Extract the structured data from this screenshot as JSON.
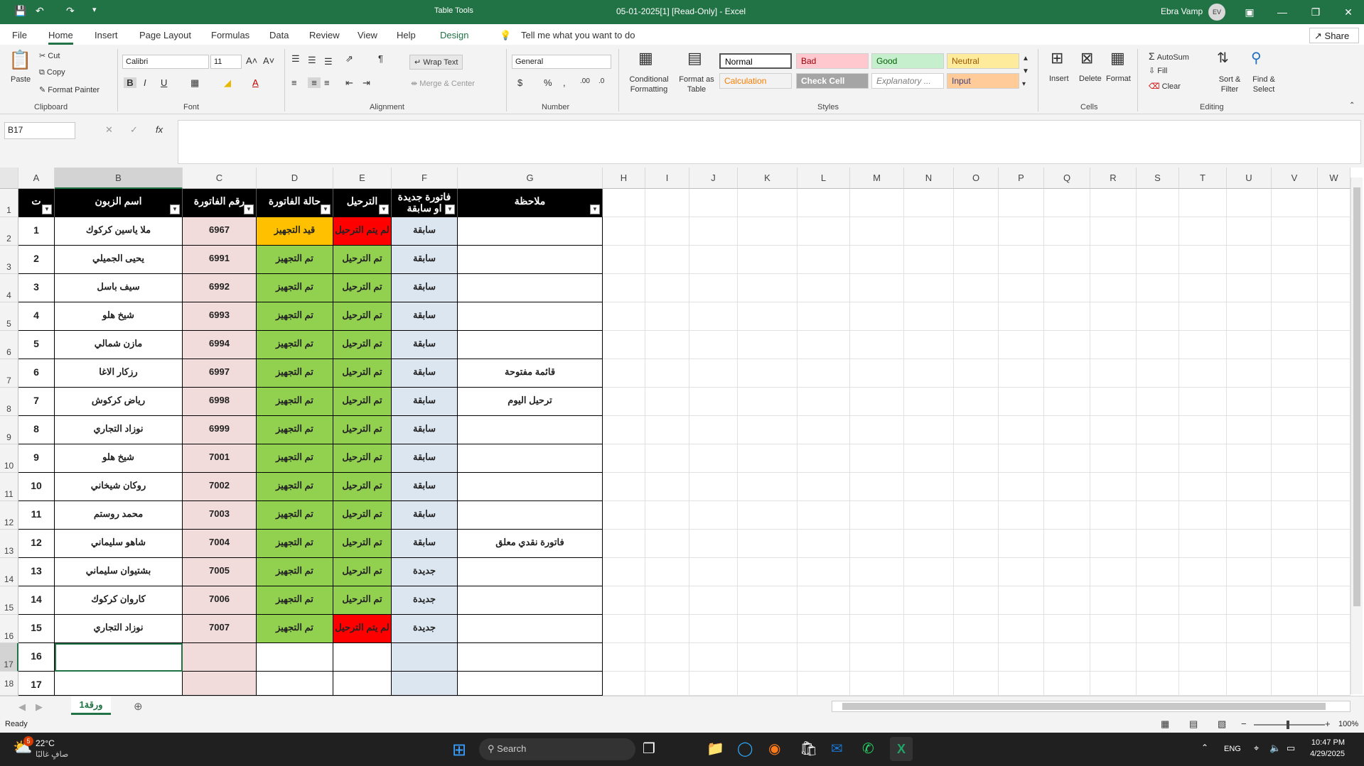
{
  "titlebar": {
    "context_tab": "Table Tools",
    "doc_title": "05-01-2025[1]  [Read-Only]  -  Excel",
    "user": "Ebra Vamp",
    "avatar": "EV"
  },
  "menu": [
    "File",
    "Home",
    "Insert",
    "Page Layout",
    "Formulas",
    "Data",
    "Review",
    "View",
    "Help",
    "Design"
  ],
  "tell_me": "Tell me what you want to do",
  "share": "Share",
  "ribbon": {
    "clipboard": {
      "paste": "Paste",
      "cut": "Cut",
      "copy": "Copy",
      "format_painter": "Format Painter",
      "group": "Clipboard"
    },
    "font": {
      "name": "Calibri",
      "size": "11",
      "group": "Font"
    },
    "alignment": {
      "wrap": "Wrap Text",
      "merge": "Merge & Center",
      "group": "Alignment"
    },
    "number": {
      "format": "General",
      "group": "Number"
    },
    "styles": {
      "cond": "Conditional Formatting",
      "format_table": "Format as Table",
      "group": "Styles",
      "cells": [
        {
          "label": "Normal",
          "bg": "#ffffff",
          "fg": "#000000"
        },
        {
          "label": "Bad",
          "bg": "#ffc7ce",
          "fg": "#9c0006"
        },
        {
          "label": "Good",
          "bg": "#c6efce",
          "fg": "#006100"
        },
        {
          "label": "Neutral",
          "bg": "#ffeb9c",
          "fg": "#9c5700"
        },
        {
          "label": "Calculation",
          "bg": "#f2f2f2",
          "fg": "#fa7d00"
        },
        {
          "label": "Check Cell",
          "bg": "#a5a5a5",
          "fg": "#ffffff"
        },
        {
          "label": "Explanatory ...",
          "bg": "#ffffff",
          "fg": "#7f7f7f"
        },
        {
          "label": "Input",
          "bg": "#ffcc99",
          "fg": "#3f3f76"
        }
      ]
    },
    "cells": {
      "insert": "Insert",
      "delete": "Delete",
      "format": "Format",
      "group": "Cells"
    },
    "editing": {
      "autosum": "AutoSum",
      "fill": "Fill",
      "clear": "Clear",
      "sort": "Sort & Filter",
      "find": "Find & Select",
      "group": "Editing"
    }
  },
  "formula": {
    "namebox": "B17",
    "fx": "fx",
    "value": ""
  },
  "columns": [
    "A",
    "B",
    "C",
    "D",
    "E",
    "F",
    "G",
    "H",
    "I",
    "J",
    "K",
    "L",
    "M",
    "N",
    "O",
    "P",
    "Q",
    "R",
    "S",
    "T",
    "U",
    "V",
    "W"
  ],
  "headers": {
    "a": "ت",
    "b": "اسم الزبون",
    "c": "رقم الفاتورة",
    "d": "حالة الفاتورة",
    "e": "الترحيل",
    "f1": "فاتورة جديدة",
    "f2": "او سابقة",
    "g": "ملاحظة"
  },
  "rows": [
    {
      "n": "1",
      "name": "ملا ياسين كركوك",
      "inv": "6967",
      "status": "قيد التجهيز",
      "ship": "لم يتم الترحيل",
      "type": "سابقة",
      "note": ""
    },
    {
      "n": "2",
      "name": "يحيى الجميلي",
      "inv": "6991",
      "status": "تم التجهيز",
      "ship": "تم الترحيل",
      "type": "سابقة",
      "note": ""
    },
    {
      "n": "3",
      "name": "سيف باسل",
      "inv": "6992",
      "status": "تم التجهيز",
      "ship": "تم الترحيل",
      "type": "سابقة",
      "note": ""
    },
    {
      "n": "4",
      "name": "شيخ هلو",
      "inv": "6993",
      "status": "تم التجهيز",
      "ship": "تم الترحيل",
      "type": "سابقة",
      "note": ""
    },
    {
      "n": "5",
      "name": "مازن شمالي",
      "inv": "6994",
      "status": "تم التجهيز",
      "ship": "تم الترحيل",
      "type": "سابقة",
      "note": ""
    },
    {
      "n": "6",
      "name": "رزكار الاغا",
      "inv": "6997",
      "status": "تم التجهيز",
      "ship": "تم الترحيل",
      "type": "سابقة",
      "note": "قائمة مفتوحة"
    },
    {
      "n": "7",
      "name": "رياض كركوش",
      "inv": "6998",
      "status": "تم التجهيز",
      "ship": "تم الترحيل",
      "type": "سابقة",
      "note": "ترحيل اليوم"
    },
    {
      "n": "8",
      "name": "نوزاد التجاري",
      "inv": "6999",
      "status": "تم التجهيز",
      "ship": "تم الترحيل",
      "type": "سابقة",
      "note": ""
    },
    {
      "n": "9",
      "name": "شيخ هلو",
      "inv": "7001",
      "status": "تم التجهيز",
      "ship": "تم الترحيل",
      "type": "سابقة",
      "note": ""
    },
    {
      "n": "10",
      "name": "روكان شيخاني",
      "inv": "7002",
      "status": "تم التجهيز",
      "ship": "تم الترحيل",
      "type": "سابقة",
      "note": ""
    },
    {
      "n": "11",
      "name": "محمد روستم",
      "inv": "7003",
      "status": "تم التجهيز",
      "ship": "تم الترحيل",
      "type": "سابقة",
      "note": ""
    },
    {
      "n": "12",
      "name": "شاهو سليماني",
      "inv": "7004",
      "status": "تم التجهيز",
      "ship": "تم الترحيل",
      "type": "سابقة",
      "note": "فاتورة نقدي معلق"
    },
    {
      "n": "13",
      "name": "بشتيوان سليماني",
      "inv": "7005",
      "status": "تم التجهيز",
      "ship": "تم الترحيل",
      "type": "جديدة",
      "note": ""
    },
    {
      "n": "14",
      "name": "كاروان كركوك",
      "inv": "7006",
      "status": "تم التجهيز",
      "ship": "تم الترحيل",
      "type": "جديدة",
      "note": ""
    },
    {
      "n": "15",
      "name": "نوزاد التجاري",
      "inv": "7007",
      "status": "تم التجهيز",
      "ship": "لم يتم الترحيل",
      "type": "جديدة",
      "note": ""
    },
    {
      "n": "16",
      "name": "",
      "inv": "",
      "status": "",
      "ship": "",
      "type": "",
      "note": ""
    },
    {
      "n": "17",
      "name": "",
      "inv": "",
      "status": "",
      "ship": "",
      "type": "",
      "note": ""
    }
  ],
  "row_numbers": [
    "1",
    "2",
    "3",
    "4",
    "5",
    "6",
    "7",
    "8",
    "9",
    "10",
    "11",
    "12",
    "13",
    "14",
    "15",
    "16",
    "17",
    "18"
  ],
  "colors": {
    "status_pending": "#ffc000",
    "status_done": "#92d050",
    "ship_no": "#ff0000",
    "ship_yes": "#92d050",
    "inv_bg": "#f2dcdb",
    "type_bg": "#dce6f1"
  },
  "sheet_tab": "ورقة1",
  "status_text": "Ready",
  "zoom": "100%",
  "taskbar": {
    "temp": "22°C",
    "weather": "صافٍ غالبًا",
    "search": "Search",
    "lang": "ENG",
    "time": "10:47 PM",
    "date": "4/29/2025",
    "badge": "5"
  }
}
